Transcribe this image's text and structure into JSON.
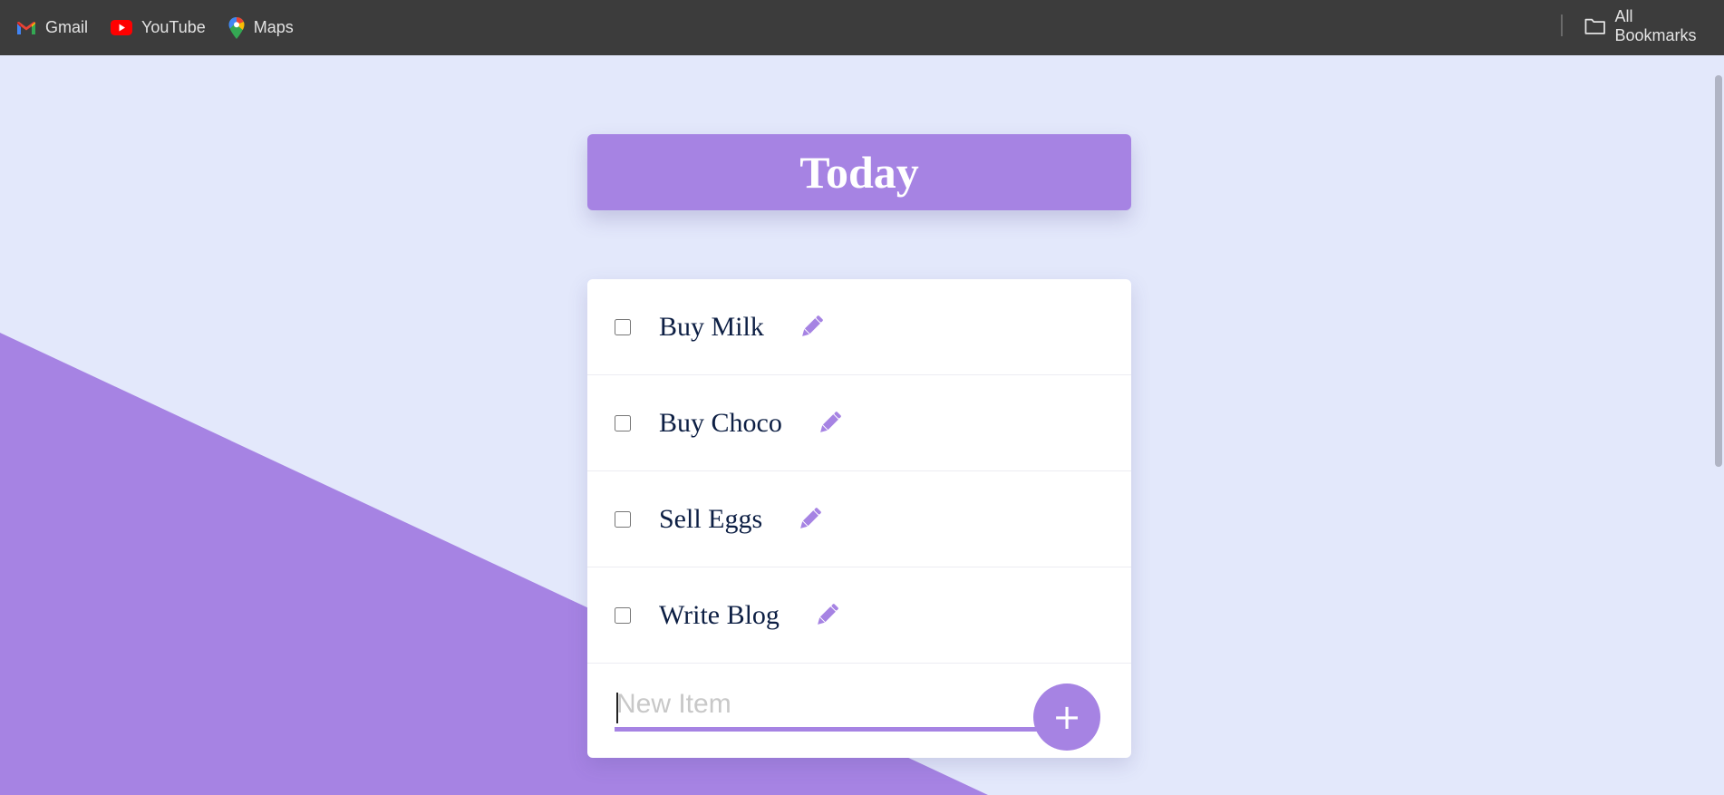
{
  "bookmarks": {
    "items": [
      {
        "label": "Gmail",
        "icon": "gmail-icon"
      },
      {
        "label": "YouTube",
        "icon": "youtube-icon"
      },
      {
        "label": "Maps",
        "icon": "maps-icon"
      }
    ],
    "all_bookmarks": {
      "label": "All Bookmarks",
      "icon": "folder-icon"
    }
  },
  "heading": {
    "title": "Today"
  },
  "todo": {
    "items": [
      {
        "text": "Buy Milk",
        "checked": false
      },
      {
        "text": "Buy Choco",
        "checked": false
      },
      {
        "text": "Sell Eggs",
        "checked": false
      },
      {
        "text": "Write Blog",
        "checked": false
      }
    ],
    "new_item": {
      "placeholder": "New Item",
      "value": ""
    },
    "add_button_label": "+"
  },
  "colors": {
    "accent": "#a683e3",
    "background": "#e3e8fb",
    "bookmarks_bar": "#3c3c3c",
    "item_text": "#0d1f44"
  }
}
